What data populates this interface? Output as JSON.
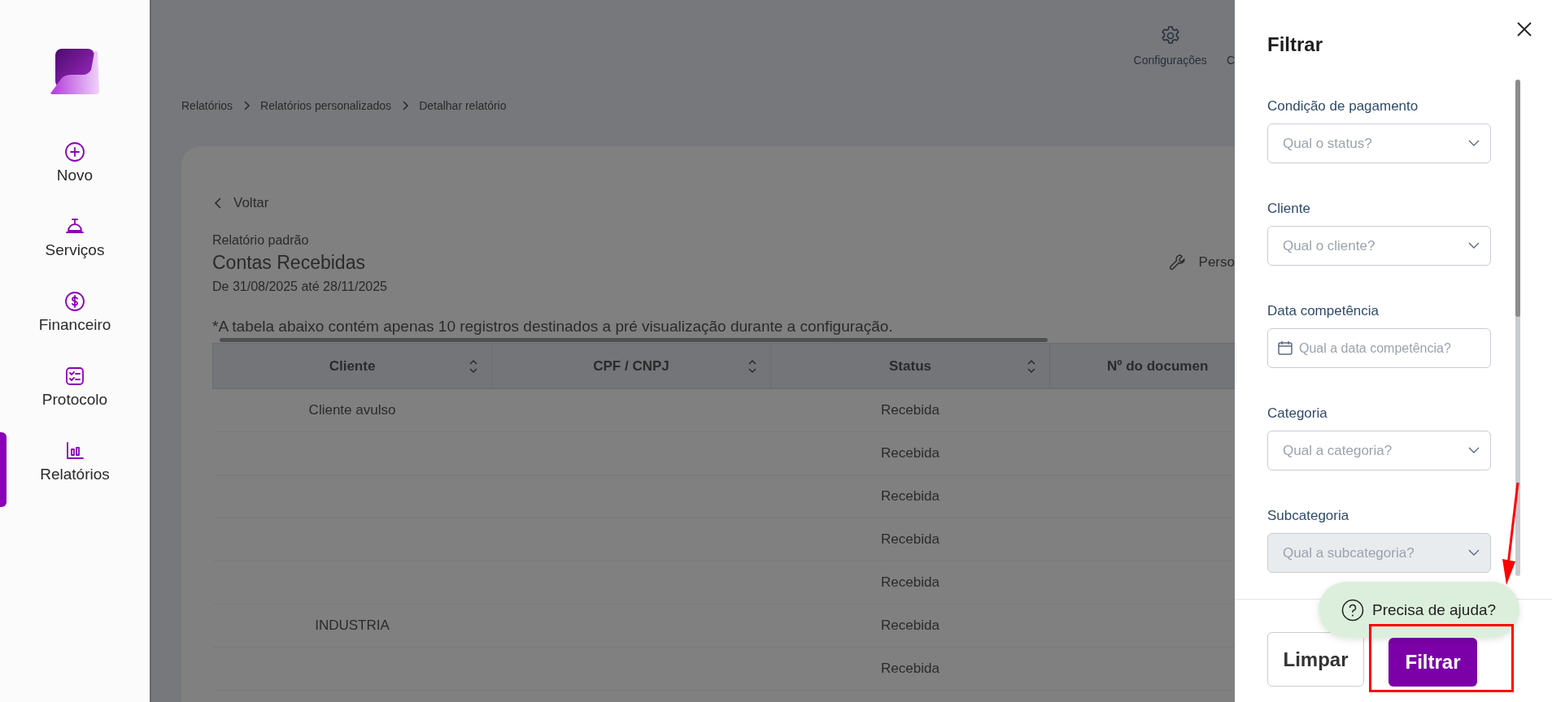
{
  "sidebar": {
    "items": [
      {
        "label": "Novo",
        "selected": false
      },
      {
        "label": "Serviços",
        "selected": false
      },
      {
        "label": "Financeiro",
        "selected": false
      },
      {
        "label": "Protocolo",
        "selected": false
      },
      {
        "label": "Relatórios",
        "selected": true
      }
    ]
  },
  "header": {
    "items": [
      {
        "label": "Configurações",
        "kind": "settings"
      },
      {
        "label": "C",
        "kind": "cut"
      }
    ]
  },
  "breadcrumb": [
    "Relatórios",
    "Relatórios personalizados",
    "Detalhar relatório"
  ],
  "report": {
    "back": "Voltar",
    "subtitle": "Relatório padrão",
    "title": "Contas Recebidas",
    "period": "De 31/08/2025 até 28/11/2025",
    "action": "Perso",
    "note": "*A tabela abaixo contém apenas 10 registros destinados a pré visualização durante a configuração."
  },
  "table": {
    "columns": [
      {
        "label": "Cliente",
        "sortable": true
      },
      {
        "label": "CPF / CNPJ",
        "sortable": true
      },
      {
        "label": "Status",
        "sortable": true
      },
      {
        "label": "Nº do documen",
        "sortable": false
      }
    ],
    "rows": [
      {
        "cliente": "Cliente avulso",
        "status": "Recebida"
      },
      {
        "status": "Recebida"
      },
      {
        "status": "Recebida"
      },
      {
        "status": "Recebida"
      },
      {
        "status": "Recebida"
      },
      {
        "cliente": "INDUSTRIA",
        "status": "Recebida"
      },
      {
        "status": "Recebida"
      }
    ]
  },
  "filter_panel": {
    "title": "Filtrar",
    "fields": [
      {
        "label": "Condição de pagamento",
        "placeholder": "Qual o status?",
        "kind": "select",
        "disabled": false
      },
      {
        "label": "Cliente",
        "placeholder": "Qual o cliente?",
        "kind": "select",
        "disabled": false
      },
      {
        "label": "Data competência",
        "placeholder": "Qual a data competência?",
        "kind": "date",
        "disabled": false
      },
      {
        "label": "Categoria",
        "placeholder": "Qual a categoria?",
        "kind": "select",
        "disabled": false
      },
      {
        "label": "Subcategoria",
        "placeholder": "Qual a subcategoria?",
        "kind": "select",
        "disabled": true
      }
    ],
    "buttons": [
      {
        "label": "Limpar",
        "kind": "secondary"
      },
      {
        "label": "Filtrar",
        "kind": "primary"
      }
    ]
  },
  "help_bubble": {
    "label": "Precisa de ajuda?"
  },
  "annotations": [
    {
      "kind": "arrow"
    },
    {
      "kind": "rectangle"
    }
  ]
}
